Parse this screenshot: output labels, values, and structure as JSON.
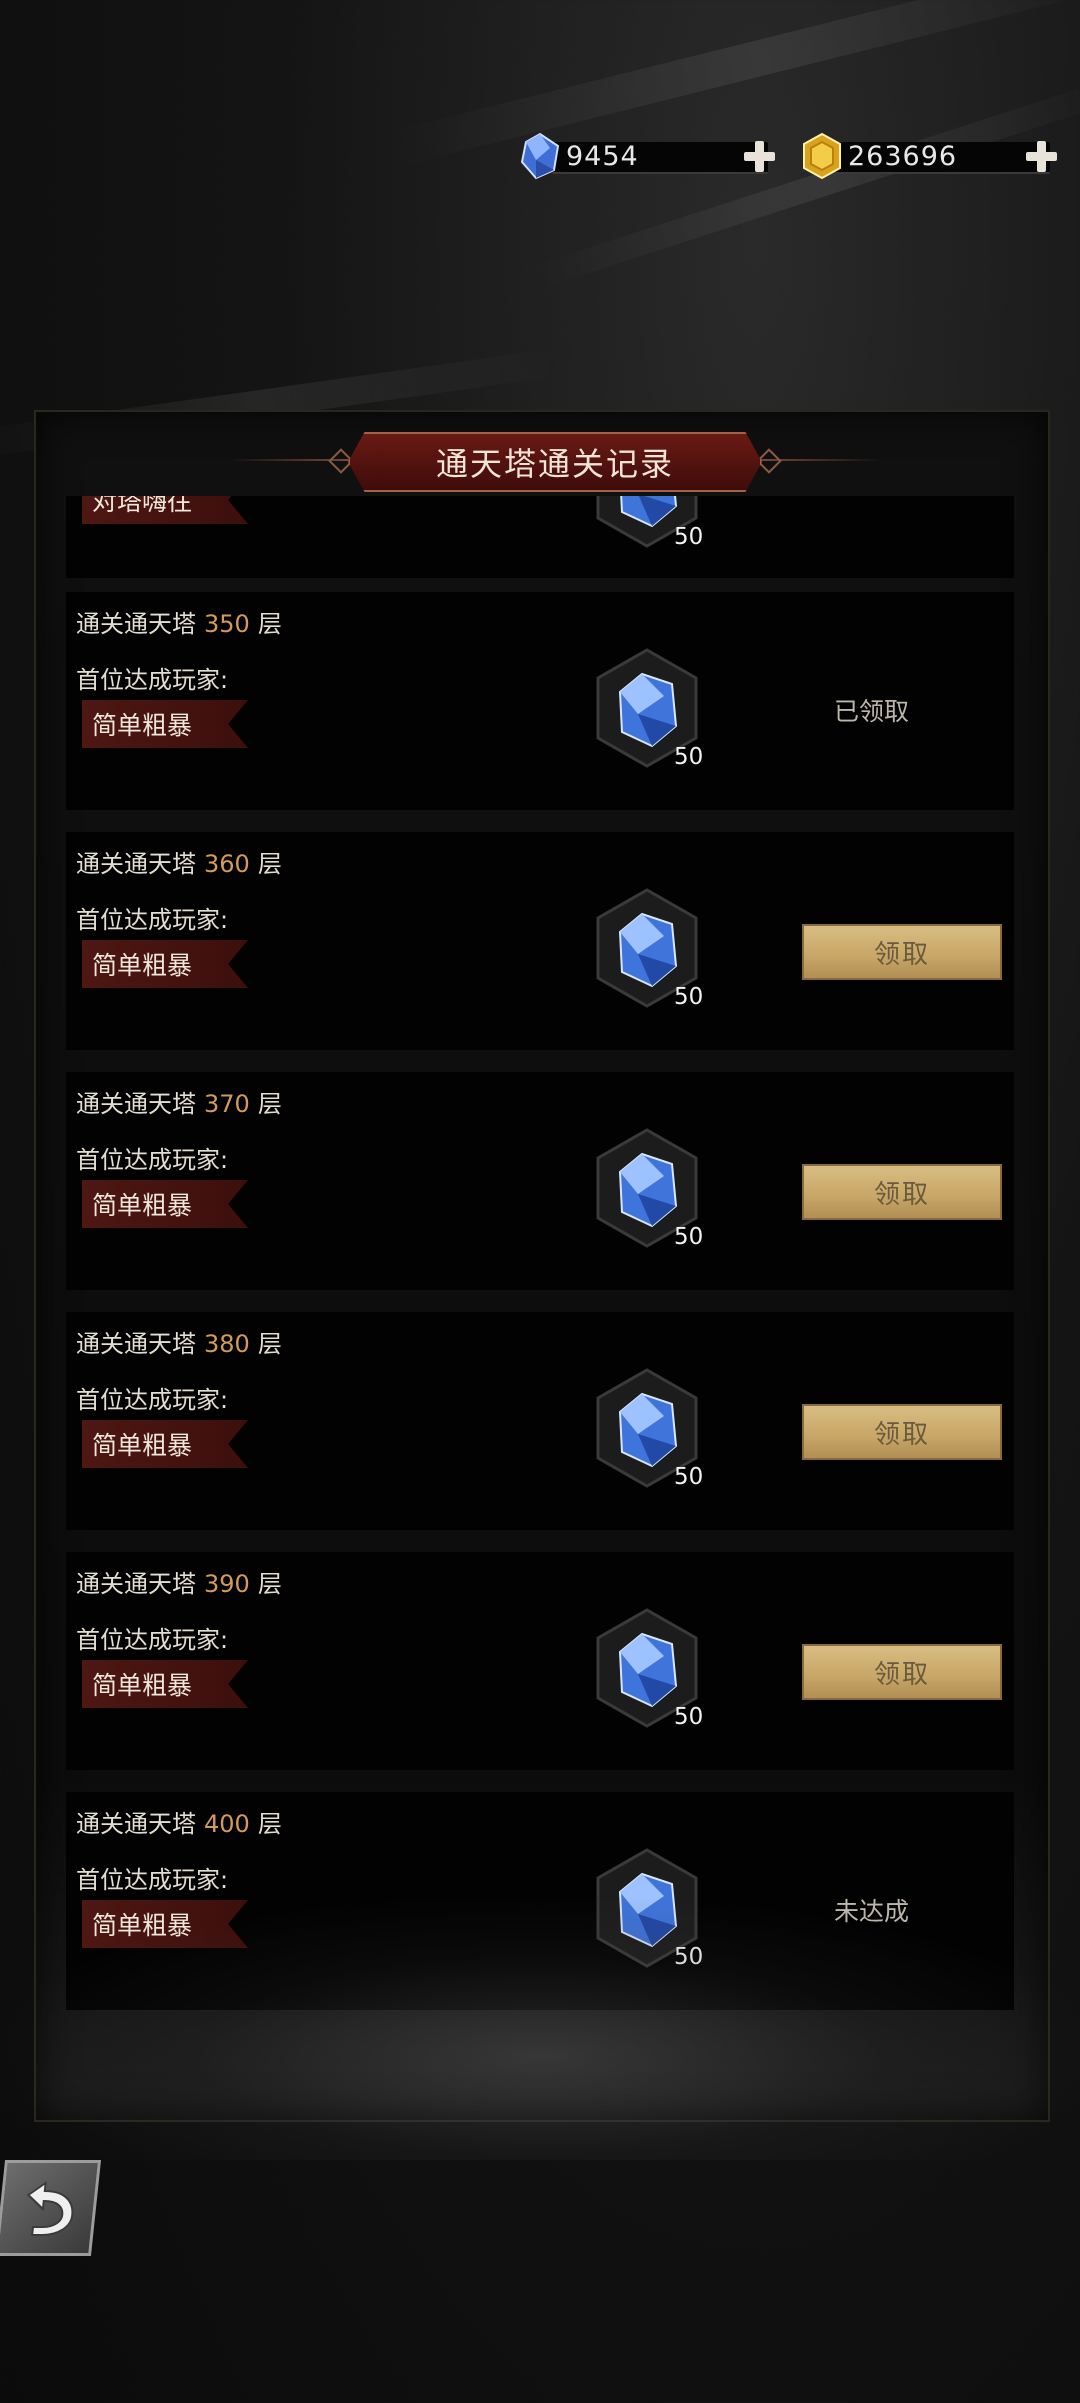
{
  "currency": {
    "gems": {
      "icon": "blue-gem-icon",
      "value": "9454"
    },
    "gold": {
      "icon": "gold-coin-icon",
      "value": "263696"
    }
  },
  "panel": {
    "title": "通天塔通关记录",
    "partial_row": {
      "tag": "对塔嗨往",
      "count": "50"
    }
  },
  "rows": [
    {
      "prefix": "通关通天塔",
      "floor": "350",
      "suffix": "层",
      "first_label": "首位达成玩家:",
      "player": "简单粗暴",
      "reward_icon": "blue-gem-icon",
      "reward_count": "50",
      "status": "claimed",
      "status_text": "已领取"
    },
    {
      "prefix": "通关通天塔",
      "floor": "360",
      "suffix": "层",
      "first_label": "首位达成玩家:",
      "player": "简单粗暴",
      "reward_icon": "blue-gem-icon",
      "reward_count": "50",
      "status": "claimable",
      "status_text": "领取"
    },
    {
      "prefix": "通关通天塔",
      "floor": "370",
      "suffix": "层",
      "first_label": "首位达成玩家:",
      "player": "简单粗暴",
      "reward_icon": "blue-gem-icon",
      "reward_count": "50",
      "status": "claimable",
      "status_text": "领取"
    },
    {
      "prefix": "通关通天塔",
      "floor": "380",
      "suffix": "层",
      "first_label": "首位达成玩家:",
      "player": "简单粗暴",
      "reward_icon": "blue-gem-icon",
      "reward_count": "50",
      "status": "claimable",
      "status_text": "领取"
    },
    {
      "prefix": "通关通天塔",
      "floor": "390",
      "suffix": "层",
      "first_label": "首位达成玩家:",
      "player": "简单粗暴",
      "reward_icon": "blue-gem-icon",
      "reward_count": "50",
      "status": "claimable",
      "status_text": "领取"
    },
    {
      "prefix": "通关通天塔",
      "floor": "400",
      "suffix": "层",
      "first_label": "首位达成玩家:",
      "player": "简单粗暴",
      "reward_icon": "blue-gem-icon",
      "reward_count": "50",
      "status": "unreached",
      "status_text": "未达成"
    }
  ],
  "footer": {
    "back_icon": "back-arrow-icon"
  },
  "colors": {
    "accent_floor": "#d49a5c",
    "title_plate": "#6a1a14",
    "claim_button": "#d2b477"
  }
}
